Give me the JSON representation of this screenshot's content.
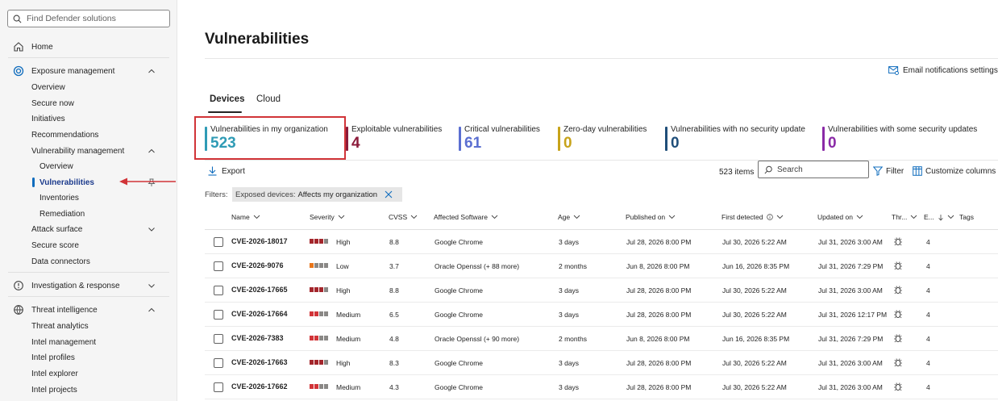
{
  "sidebar": {
    "search_placeholder": "Find Defender solutions",
    "items": [
      {
        "label": "Home"
      },
      {
        "label": "Exposure management"
      },
      {
        "label": "Overview"
      },
      {
        "label": "Secure now"
      },
      {
        "label": "Initiatives"
      },
      {
        "label": "Recommendations"
      },
      {
        "label": "Vulnerability management"
      },
      {
        "label": "Overview"
      },
      {
        "label": "Vulnerabilities"
      },
      {
        "label": "Inventories"
      },
      {
        "label": "Remediation"
      },
      {
        "label": "Attack surface"
      },
      {
        "label": "Secure score"
      },
      {
        "label": "Data connectors"
      },
      {
        "label": "Investigation & response"
      },
      {
        "label": "Threat intelligence"
      },
      {
        "label": "Threat analytics"
      },
      {
        "label": "Intel management"
      },
      {
        "label": "Intel profiles"
      },
      {
        "label": "Intel explorer"
      },
      {
        "label": "Intel projects"
      }
    ]
  },
  "page": {
    "title": "Vulnerabilities",
    "email_notifications": "Email notifications settings",
    "tabs": [
      {
        "label": "Devices"
      },
      {
        "label": "Cloud"
      }
    ]
  },
  "kpis": [
    {
      "label": "Vulnerabilities in my organization",
      "value": "523",
      "color": "#2f9bb5"
    },
    {
      "label": "Exploitable vulnerabilities",
      "value": "4",
      "color": "#8b1a3a"
    },
    {
      "label": "Critical vulnerabilities",
      "value": "61",
      "color": "#5b6fd1"
    },
    {
      "label": "Zero-day vulnerabilities",
      "value": "0",
      "color": "#c7a31a"
    },
    {
      "label": "Vulnerabilities with no security update",
      "value": "0",
      "color": "#1f4e79"
    },
    {
      "label": "Vulnerabilities with some security updates",
      "value": "0",
      "color": "#8a2aa7"
    }
  ],
  "toolbar": {
    "export": "Export",
    "count": "523 items",
    "search_placeholder": "Search",
    "filter": "Filter",
    "customize": "Customize columns"
  },
  "filters": {
    "label": "Filters:",
    "chip_key": "Exposed devices:",
    "chip_value": "Affects my organization"
  },
  "table": {
    "columns": [
      "Name",
      "Severity",
      "CVSS",
      "Affected Software",
      "Age",
      "Published on",
      "First detected",
      "Updated on",
      "Thr...",
      "E...",
      "Tags"
    ],
    "rows": [
      {
        "name": "CVE-2026-18017",
        "severity": "High",
        "cvss": "8.8",
        "software": "Google Chrome",
        "age": "3 days",
        "published": "Jul 28, 2026 8:00 PM",
        "first": "Jul 30, 2026 5:22 AM",
        "updated": "Jul 31, 2026 3:00 AM",
        "e": "4"
      },
      {
        "name": "CVE-2026-9076",
        "severity": "Low",
        "cvss": "3.7",
        "software": "Oracle Openssl (+ 88 more)",
        "age": "2 months",
        "published": "Jun 8, 2026 8:00 PM",
        "first": "Jun 16, 2026 8:35 PM",
        "updated": "Jul 31, 2026 7:29 PM",
        "e": "4"
      },
      {
        "name": "CVE-2026-17665",
        "severity": "High",
        "cvss": "8.8",
        "software": "Google Chrome",
        "age": "3 days",
        "published": "Jul 28, 2026 8:00 PM",
        "first": "Jul 30, 2026 5:22 AM",
        "updated": "Jul 31, 2026 3:00 AM",
        "e": "4"
      },
      {
        "name": "CVE-2026-17664",
        "severity": "Medium",
        "cvss": "6.5",
        "software": "Google Chrome",
        "age": "3 days",
        "published": "Jul 28, 2026 8:00 PM",
        "first": "Jul 30, 2026 5:22 AM",
        "updated": "Jul 31, 2026 12:17 PM",
        "e": "4"
      },
      {
        "name": "CVE-2026-7383",
        "severity": "Medium",
        "cvss": "4.8",
        "software": "Oracle Openssl (+ 90 more)",
        "age": "2 months",
        "published": "Jun 8, 2026 8:00 PM",
        "first": "Jun 16, 2026 8:35 PM",
        "updated": "Jul 31, 2026 7:29 PM",
        "e": "4"
      },
      {
        "name": "CVE-2026-17663",
        "severity": "High",
        "cvss": "8.3",
        "software": "Google Chrome",
        "age": "3 days",
        "published": "Jul 28, 2026 8:00 PM",
        "first": "Jul 30, 2026 5:22 AM",
        "updated": "Jul 31, 2026 3:00 AM",
        "e": "4"
      },
      {
        "name": "CVE-2026-17662",
        "severity": "Medium",
        "cvss": "4.3",
        "software": "Google Chrome",
        "age": "3 days",
        "published": "Jul 28, 2026 8:00 PM",
        "first": "Jul 30, 2026 5:22 AM",
        "updated": "Jul 31, 2026 3:00 AM",
        "e": "4"
      }
    ]
  },
  "colors": {
    "severity_high": "#a4262c",
    "severity_medium": "#d13438",
    "severity_low": "#e8751a",
    "severity_empty": "#8a8886",
    "annotation_red": "#d13438"
  }
}
